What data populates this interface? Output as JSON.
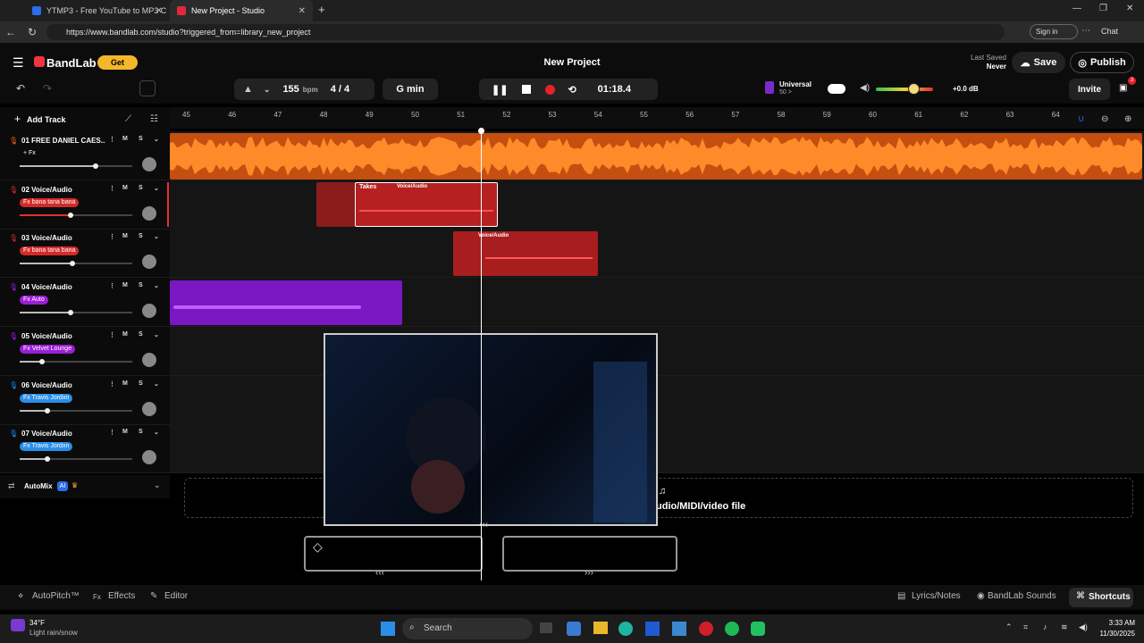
{
  "browser": {
    "tabs": [
      {
        "title": "YTMP3 - Free YouTube to MP3 C"
      },
      {
        "title": "New Project - Studio"
      }
    ],
    "url": "https://www.bandlab.com/studio?triggered_from=library_new_project",
    "sign_in": "Sign in",
    "chat": "Chat"
  },
  "app": {
    "logo": "BandLab",
    "get_label": "Get",
    "project_title": "New Project",
    "last_saved_label": "Last Saved",
    "last_saved_value": "Never",
    "save_label": "Save",
    "publish_label": "Publish",
    "invite_label": "Invite",
    "notif_count": "3"
  },
  "transport": {
    "bpm": "155",
    "bpm_unit": "bpm",
    "time_sig": "4 / 4",
    "key": "G min",
    "time": "01:18.4",
    "preset_name": "Universal",
    "preset_sub": "50 >",
    "master_db": "+0.0 dB"
  },
  "tracks_panel": {
    "add_track": "Add Track"
  },
  "ruler": [
    "45",
    "46",
    "47",
    "48",
    "49",
    "50",
    "51",
    "52",
    "53",
    "54",
    "55",
    "56",
    "57",
    "58",
    "59",
    "60",
    "61",
    "62",
    "63",
    "64"
  ],
  "tracks": [
    {
      "name": "01  FREE DANIEL CAES...",
      "fx": "+ Fx",
      "fx_color": "#0b0b0b",
      "color": "#ff6a13",
      "vol": 0.68
    },
    {
      "name": "02  Voice/Audio",
      "fx": "Fx bana tana bana",
      "fx_color": "#d42a2a",
      "color": "#e03030",
      "vol": 0.46
    },
    {
      "name": "03  Voice/Audio",
      "fx": "Fx bana tana bana",
      "fx_color": "#d42a2a",
      "color": "#e03030",
      "vol": 0.48
    },
    {
      "name": "04  Voice/Audio",
      "fx": "Fx Auto",
      "fx_color": "#9b1fd6",
      "color": "#a020f0",
      "vol": 0.46
    },
    {
      "name": "05  Voice/Audio",
      "fx": "Fx Velvet Lounge",
      "fx_color": "#9b1fd6",
      "color": "#a020f0",
      "vol": 0.21
    },
    {
      "name": "06  Voice/Audio",
      "fx": "Fx Travis Jordxn",
      "fx_color": "#2a8ee8",
      "color": "#2a8ee8",
      "vol": 0.25
    },
    {
      "name": "07  Voice/Audio",
      "fx": "Fx Travis Jordxn",
      "fx_color": "#2a8ee8",
      "color": "#2a8ee8",
      "vol": 0.25
    }
  ],
  "clips": {
    "takes_label": "Takes",
    "voice_audio_label": "Voice/Audio",
    "voice_audio_label_2": "Voice/Audio"
  },
  "automix": {
    "label": "AutoMix",
    "ai": "AI"
  },
  "dropzone": {
    "text": "udio/MIDI/video file"
  },
  "bottom": {
    "autopitch": "AutoPitch™",
    "effects": "Effects",
    "editor": "Editor",
    "lyrics": "Lyrics/Notes",
    "sounds": "BandLab Sounds",
    "shortcuts": "Shortcuts"
  },
  "taskbar": {
    "weather_temp": "34°F",
    "weather_desc": "Light rain/snow",
    "search": "Search",
    "time": "3:33 AM",
    "date": "11/30/2025"
  }
}
